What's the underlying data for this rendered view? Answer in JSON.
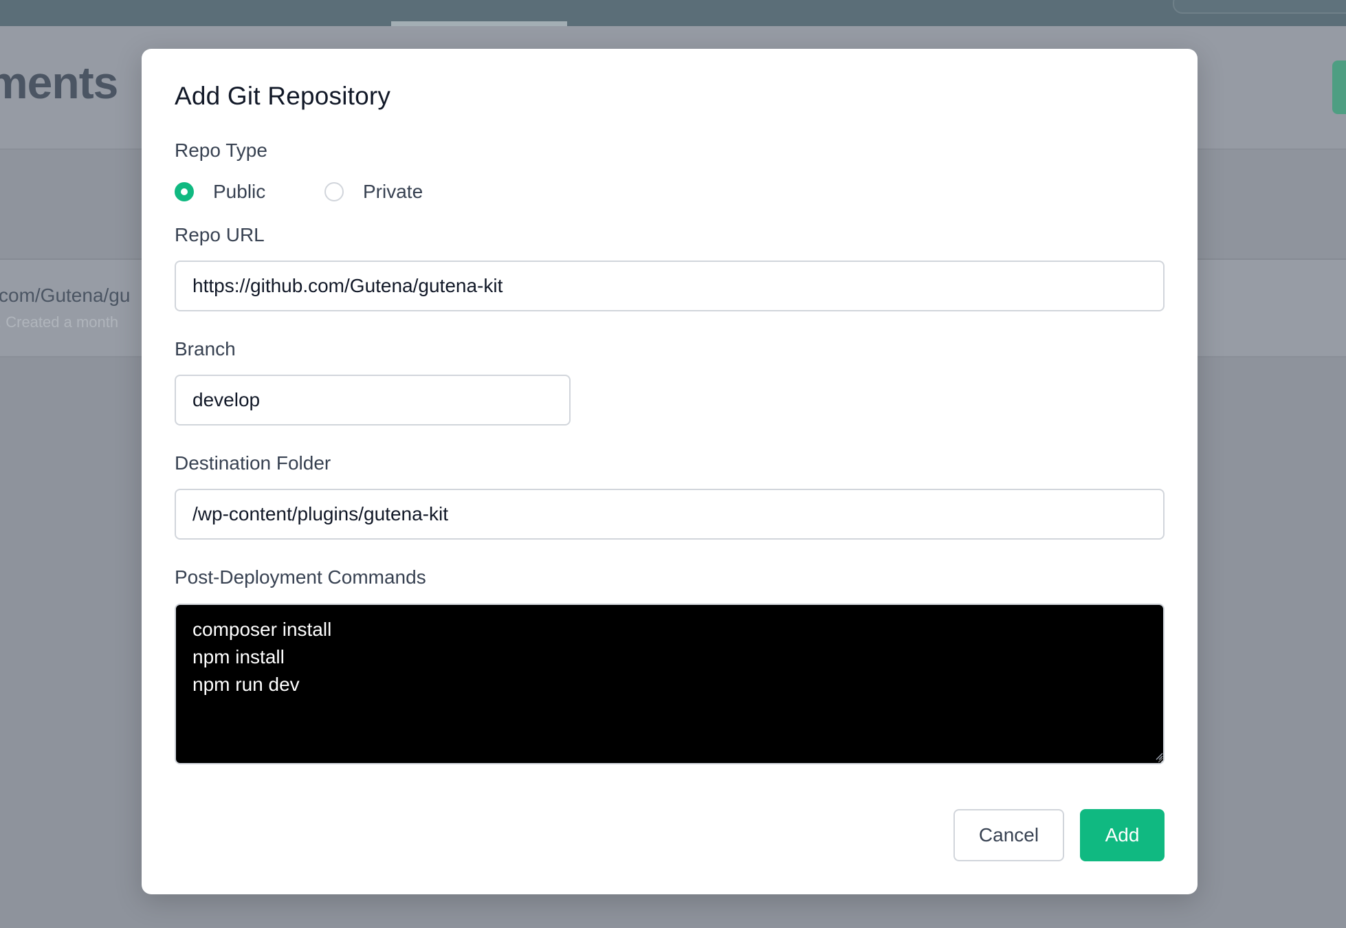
{
  "background": {
    "page_title_fragment": "ments",
    "row": {
      "repo_url_fragment": "com/Gutena/gu",
      "meta_fragment": ",  Created a month"
    }
  },
  "modal": {
    "title": "Add Git Repository",
    "repo_type": {
      "label": "Repo Type",
      "options": [
        {
          "label": "Public",
          "checked": true
        },
        {
          "label": "Private",
          "checked": false
        }
      ]
    },
    "repo_url": {
      "label": "Repo URL",
      "value": "https://github.com/Gutena/gutena-kit"
    },
    "branch": {
      "label": "Branch",
      "value": "develop"
    },
    "destination_folder": {
      "label": "Destination Folder",
      "value": "/wp-content/plugins/gutena-kit"
    },
    "post_deployment_commands": {
      "label": "Post-Deployment Commands",
      "value": "composer install\nnpm install\nnpm run dev"
    },
    "buttons": {
      "cancel": "Cancel",
      "add": "Add"
    }
  },
  "colors": {
    "accent": "#10b981",
    "overlay": "#8e939c",
    "topbar": "#5b6e78",
    "text_primary": "#111827",
    "text_label": "#374151",
    "border": "#d1d5db",
    "commands_bg": "#000000"
  },
  "icons": {
    "radio_checked": "radio-checked-icon",
    "radio_unchecked": "radio-unchecked-icon",
    "resize": "resize-grip-icon"
  }
}
